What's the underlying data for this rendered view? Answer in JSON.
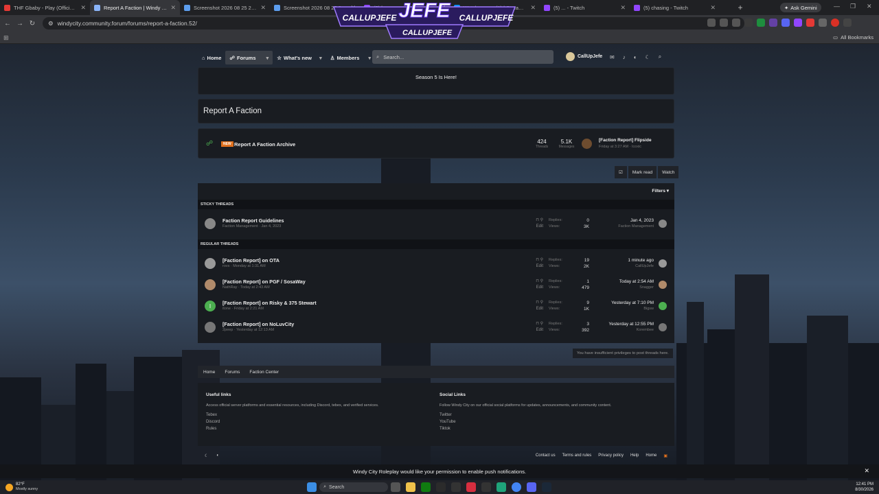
{
  "browser": {
    "tabs": [
      {
        "title": "THF Gbaby - Play (Official M",
        "color": "#e53935",
        "active": false
      },
      {
        "title": "Report A Faction | Windy City R",
        "color": "#8ab4f8",
        "active": true
      },
      {
        "title": "Screenshot 2026 08 25 231510",
        "color": "#5c9ded",
        "active": false
      },
      {
        "title": "Screenshot 2026 08 25 2202",
        "color": "#5c9ded",
        "active": false
      },
      {
        "title": "(5) bra",
        "color": "#9146ff",
        "active": false
      },
      {
        "title": "Watch noway (1) | Streamable",
        "color": "#0f90fa",
        "active": false
      },
      {
        "title": "(5) ... - Twitch",
        "color": "#9146ff",
        "active": false
      },
      {
        "title": "(5) chasing - Twitch",
        "color": "#9146ff",
        "active": false
      }
    ],
    "gemini_label": "Ask Gemini",
    "url": "windycity.community.forum/forums/report-a-faction.52/",
    "all_bookmarks": "All Bookmarks"
  },
  "stream_overlay": {
    "logo": "JEFE",
    "handle1": "CALLUPJEFE",
    "handle2": "CALLUPJEFE",
    "handle3": "CALLUPJEFE"
  },
  "nav": {
    "home": "Home",
    "forums": "Forums",
    "whats_new": "What's new",
    "members": "Members",
    "search_placeholder": "Search...",
    "username": "CallUpJefe"
  },
  "banner": {
    "text": "Season 5 Is Here!"
  },
  "page_title": "Report A Faction",
  "subforum": {
    "badge": "NEW",
    "title": "Report A Faction Archive",
    "threads_value": "424",
    "threads_label": "Threads",
    "messages_value": "5.1K",
    "messages_label": "Messages",
    "latest_title": "[Faction Report] Flipside",
    "latest_meta": "Friday at 3:27 AM · Icoxic"
  },
  "actions": {
    "mark_read": "Mark read",
    "watch": "Watch",
    "filters": "Filters ▾"
  },
  "sticky_label": "STICKY THREADS",
  "regular_label": "REGULAR THREADS",
  "stats_labels": {
    "replies": "Replies:",
    "views": "Views:"
  },
  "edit_label": "Edit",
  "sticky_threads": [
    {
      "title": "Faction Report Guidelines",
      "meta": "Faction Management · Jan 4, 2023",
      "replies": "0",
      "views": "3K",
      "last_date": "Jan 4, 2023",
      "last_user": "Faction Management",
      "avatar_color": "#888"
    }
  ],
  "threads": [
    {
      "title": "[Faction Report] on OTA",
      "meta": "rovs · Monday at 1:31 AM",
      "replies": "19",
      "views": "2K",
      "last_date": "1 minute ago",
      "last_user": "CallUpJefe",
      "avatar_color": "#999"
    },
    {
      "title": "[Faction Report] on PGF / SosaWay",
      "meta": "NathRay · Today at 2:43 AM",
      "replies": "1",
      "views": "479",
      "last_date": "Today at 2:54 AM",
      "last_user": "Snagger",
      "avatar_color": "#b08a6a"
    },
    {
      "title": "[Faction Report] on Risky & 375 Stewart",
      "meta": "itone · Friday at 2:21 AM",
      "replies": "9",
      "views": "1K",
      "last_date": "Yesterday at 7:10 PM",
      "last_user": "Bigsw",
      "avatar_color": "#4caf50",
      "avatar_letter": "I"
    },
    {
      "title": "[Faction Report] on NoLuvCity",
      "meta": "2peep · Yesterday at 12:13 AM",
      "replies": "3",
      "views": "392",
      "last_date": "Yesterday at 12:55 PM",
      "last_user": "Korembee",
      "avatar_color": "#777"
    }
  ],
  "no_privileges": "You have insufficient privileges to post threads here.",
  "breadcrumbs": [
    "Home",
    "Forums",
    "Faction Center"
  ],
  "footer": {
    "useful_title": "Useful links",
    "useful_desc": "Access official server platforms and essential resources, including Discord, tebex, and verified services.",
    "useful_links": [
      "Tebex",
      "Discord",
      "Rules"
    ],
    "social_title": "Social Links",
    "social_desc": "Follow Windy City on our official social platforms for updates, announcements, and community content.",
    "social_links": [
      "Twitter",
      "YouTube",
      "Tiktok"
    ],
    "bottom_links": [
      "Contact us",
      "Terms and rules",
      "Privacy policy",
      "Help",
      "Home"
    ]
  },
  "notification": {
    "text_prefix": "Windy City Roleplay would like your permission to",
    "text_action": "enable push notifications."
  },
  "taskbar": {
    "temp": "82°F",
    "weather": "Mostly sunny",
    "search": "Search",
    "time": "12:41 PM",
    "date": "8/30/2026"
  }
}
